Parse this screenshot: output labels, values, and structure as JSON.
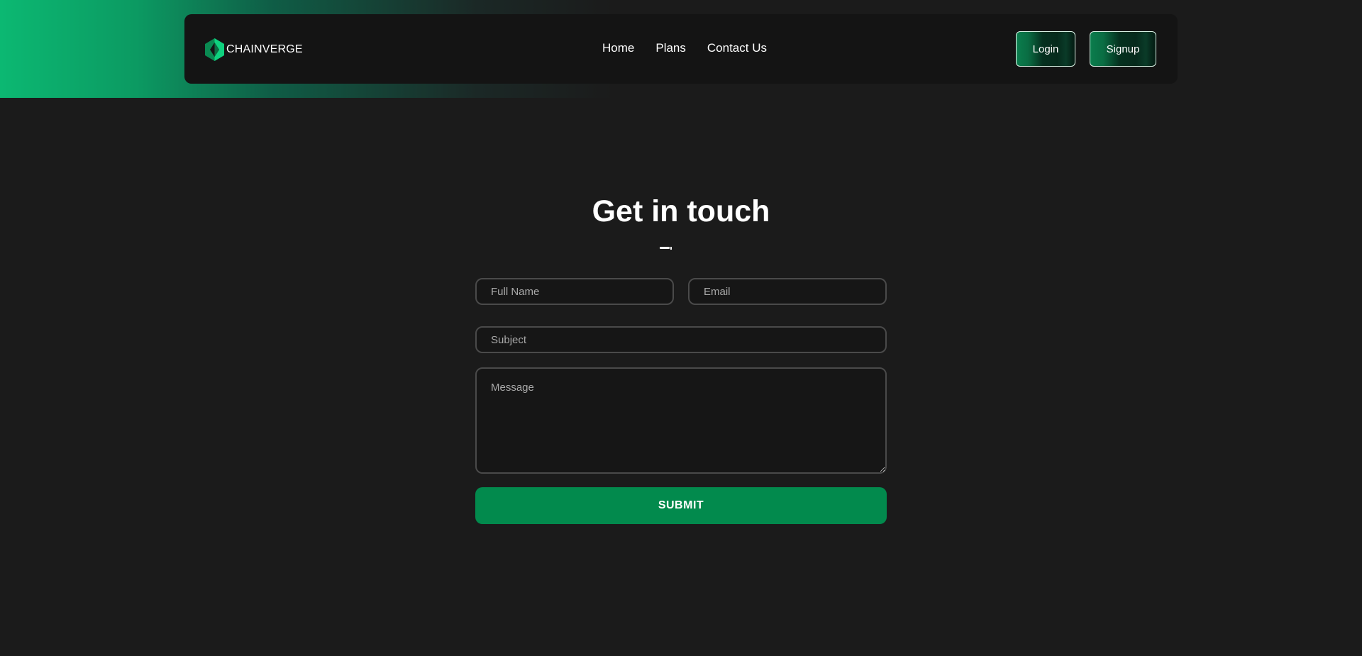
{
  "brand": {
    "name": "CHAINVERGE",
    "icon": "chainverge-logo-icon",
    "accent_colors": [
      "#0fd17e",
      "#0a8a52"
    ]
  },
  "nav": {
    "links": [
      {
        "label": "Home"
      },
      {
        "label": "Plans"
      },
      {
        "label": "Contact Us"
      }
    ],
    "login_label": "Login",
    "signup_label": "Signup"
  },
  "contact": {
    "heading": "Get in touch",
    "fields": {
      "full_name_placeholder": "Full Name",
      "email_placeholder": "Email",
      "subject_placeholder": "Subject",
      "message_placeholder": "Message"
    },
    "submit_label": "SUBMIT"
  },
  "colors": {
    "background": "#1b1b1b",
    "navbar": "#141414",
    "primary_green": "#028a4d",
    "glow_green": "#0cb872"
  }
}
